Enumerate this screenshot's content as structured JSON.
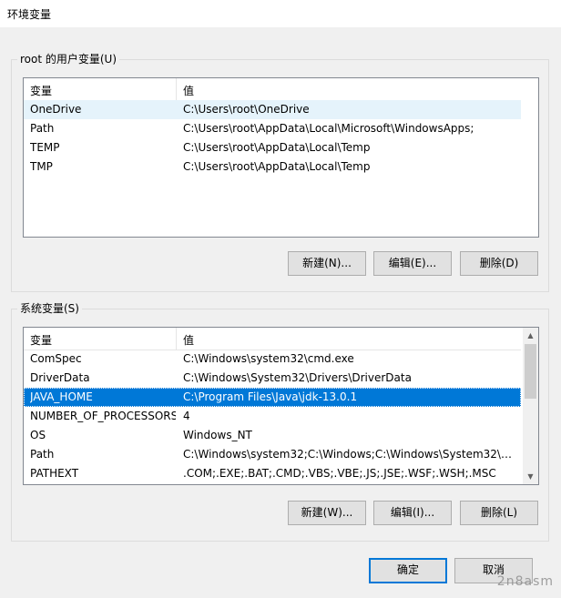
{
  "window": {
    "title": "环境变量"
  },
  "user_vars": {
    "group_label": "root 的用户变量(U)",
    "columns": [
      "变量",
      "值"
    ],
    "rows": [
      {
        "name": "OneDrive",
        "value": "C:\\Users\\root\\OneDrive"
      },
      {
        "name": "Path",
        "value": "C:\\Users\\root\\AppData\\Local\\Microsoft\\WindowsApps;"
      },
      {
        "name": "TEMP",
        "value": "C:\\Users\\root\\AppData\\Local\\Temp"
      },
      {
        "name": "TMP",
        "value": "C:\\Users\\root\\AppData\\Local\\Temp"
      }
    ],
    "buttons": {
      "new": "新建(N)...",
      "edit": "编辑(E)...",
      "delete": "删除(D)"
    }
  },
  "system_vars": {
    "group_label": "系统变量(S)",
    "columns": [
      "变量",
      "值"
    ],
    "rows": [
      {
        "name": "ComSpec",
        "value": "C:\\Windows\\system32\\cmd.exe"
      },
      {
        "name": "DriverData",
        "value": "C:\\Windows\\System32\\Drivers\\DriverData"
      },
      {
        "name": "JAVA_HOME",
        "value": "C:\\Program Files\\Java\\jdk-13.0.1"
      },
      {
        "name": "NUMBER_OF_PROCESSORS",
        "value": "4"
      },
      {
        "name": "OS",
        "value": "Windows_NT"
      },
      {
        "name": "Path",
        "value": "C:\\Windows\\system32;C:\\Windows;C:\\Windows\\System32\\Wb..."
      },
      {
        "name": "PATHEXT",
        "value": ".COM;.EXE;.BAT;.CMD;.VBS;.VBE;.JS;.JSE;.WSF;.WSH;.MSC"
      }
    ],
    "buttons": {
      "new": "新建(W)...",
      "edit": "编辑(I)...",
      "delete": "删除(L)"
    }
  },
  "footer": {
    "ok": "确定",
    "cancel": "取消"
  },
  "watermark": "2n8asm",
  "colors": {
    "selection": "#0078d7",
    "hover": "#e5f3fb",
    "default_button_border": "#0078d7"
  }
}
